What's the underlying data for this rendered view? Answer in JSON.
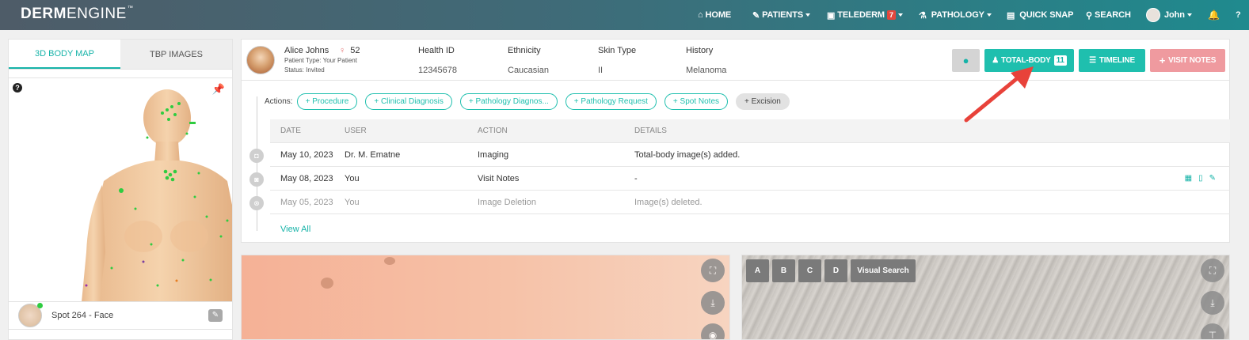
{
  "app": {
    "logo_bold": "DERM",
    "logo_light": "ENGINE",
    "logo_tm": "™"
  },
  "nav": {
    "home": "HOME",
    "patients": "PATIENTS",
    "telederm": "TELEDERM",
    "telederm_count": "7",
    "pathology": "PATHOLOGY",
    "quick_snap": "QUICK SNAP",
    "search": "SEARCH",
    "user": "John"
  },
  "left_tabs": {
    "body_map": "3D BODY MAP",
    "tbp_images": "TBP IMAGES"
  },
  "spot": {
    "label": "Spot 264 - Face"
  },
  "patient": {
    "name": "Alice Johns",
    "age": "52",
    "type_label": "Patient Type:",
    "type_value": "Your Patient",
    "status_label": "Status:",
    "status_value": "Invited",
    "fields": [
      {
        "label": "Health ID",
        "value": "12345678"
      },
      {
        "label": "Ethnicity",
        "value": "Caucasian"
      },
      {
        "label": "Skin Type",
        "value": "II"
      },
      {
        "label": "History",
        "value": "Melanoma"
      }
    ]
  },
  "buttons": {
    "total_body": "TOTAL-BODY",
    "total_body_count": "11",
    "timeline": "TIMELINE",
    "visit_notes": "VISIT NOTES"
  },
  "actions": {
    "label": "Actions:",
    "items": [
      "+ Procedure",
      "+ Clinical Diagnosis",
      "+ Pathology Diagnos...",
      "+ Pathology Request",
      "+ Spot Notes",
      "+ Excision"
    ]
  },
  "table": {
    "headers": [
      "DATE",
      "USER",
      "ACTION",
      "DETAILS"
    ],
    "rows": [
      {
        "date": "May 10, 2023",
        "user": "Dr. M. Ematne",
        "action": "Imaging",
        "details": "Total-body image(s) added."
      },
      {
        "date": "May 08, 2023",
        "user": "You",
        "action": "Visit Notes",
        "details": "-"
      },
      {
        "date": "May 05, 2023",
        "user": "You",
        "action": "Image Deletion",
        "details": "Image(s) deleted."
      }
    ],
    "view_all": "View All"
  },
  "image_controls": {
    "a": "A",
    "b": "B",
    "c": "C",
    "d": "D",
    "visual_search": "Visual Search"
  },
  "colors": {
    "accent": "#1fbfae",
    "visit_notes": "#ef9a9f",
    "annotation_arrow": "#e8423a"
  }
}
